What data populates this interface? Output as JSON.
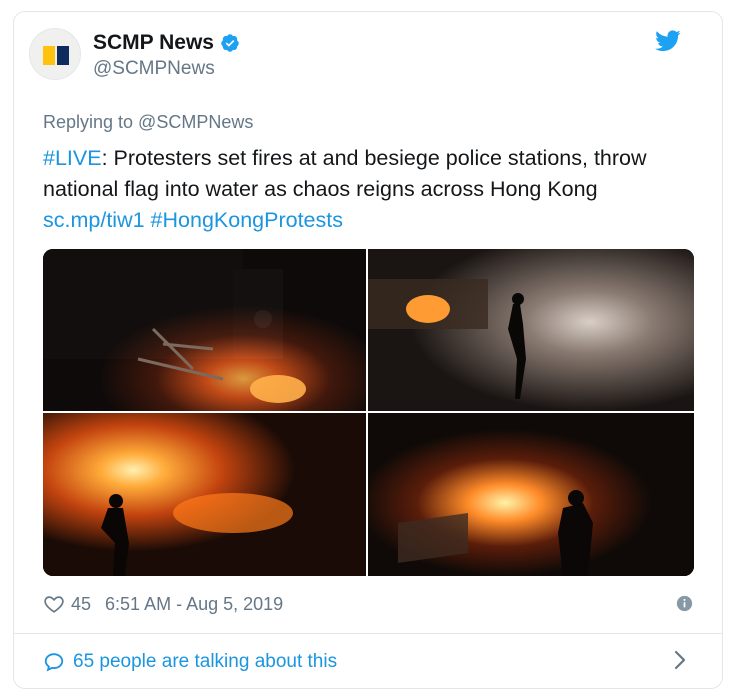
{
  "account": {
    "name": "SCMP News",
    "handle": "@SCMPNews",
    "verified": true,
    "brand_yellow": "#ffc20e",
    "brand_navy": "#0d2b5c"
  },
  "tweet": {
    "reply_to": "Replying to @SCMPNews",
    "hashtag_live": "#LIVE",
    "body": ": Protesters set fires at and besiege police stations, throw national flag into water as chaos reigns across Hong Kong",
    "link": "sc.mp/tiw1",
    "hashtag_topic": "#HongKongProtests",
    "photos": [
      "photo-1",
      "photo-2",
      "photo-3",
      "photo-4"
    ]
  },
  "meta": {
    "likes": "45",
    "timestamp": "6:51 AM - Aug 5, 2019"
  },
  "footer": {
    "talking": "65 people are talking about this"
  },
  "icons": {
    "like": "heart-icon",
    "info": "info-icon",
    "platform": "twitter-bird-icon",
    "verified": "verified-badge-icon",
    "reply": "speech-bubble-icon",
    "chevron": "chevron-right-icon"
  },
  "colors": {
    "link": "#1b95e0",
    "muted": "#657786",
    "text": "#14171a",
    "border": "#e1e8ed"
  }
}
